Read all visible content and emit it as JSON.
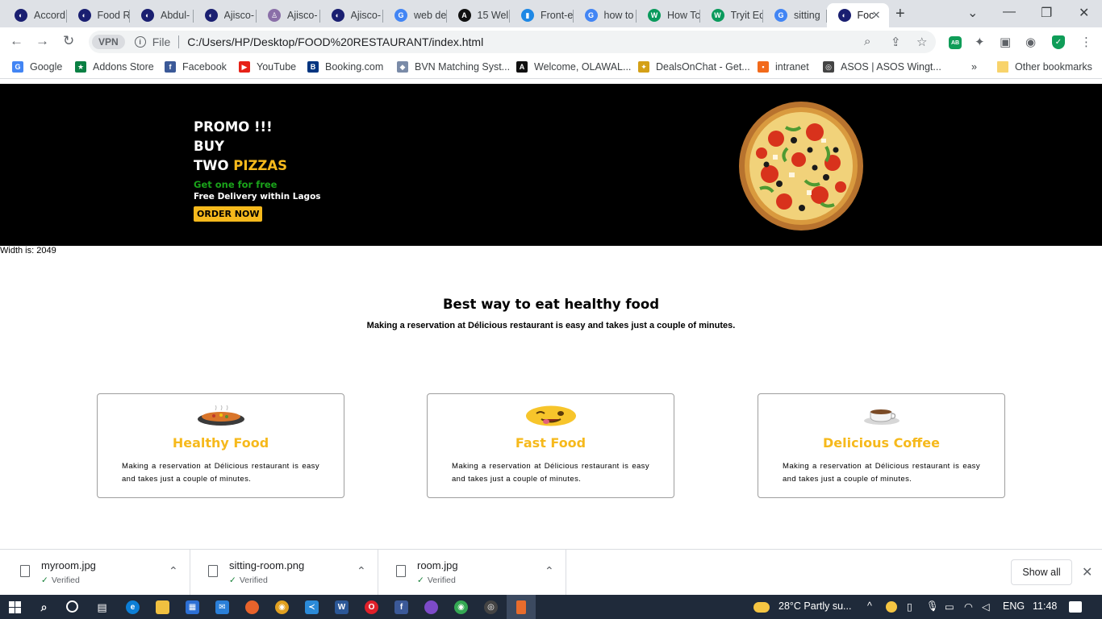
{
  "browser": {
    "tabs": [
      {
        "label": "Accord",
        "color": "#1a1f71",
        "glyph": "◐"
      },
      {
        "label": "Food R",
        "color": "#1a1f71",
        "glyph": "◐"
      },
      {
        "label": "Abdul-",
        "color": "#1a1f71",
        "glyph": "◐"
      },
      {
        "label": "Ajisco-",
        "color": "#1a1f71",
        "glyph": "◐"
      },
      {
        "label": "Ajisco-",
        "color": "#8a6fa8",
        "glyph": "♙"
      },
      {
        "label": "Ajisco-",
        "color": "#1a1f71",
        "glyph": "◐"
      },
      {
        "label": "web de",
        "color": "#4285f4",
        "glyph": "G"
      },
      {
        "label": "15 Wel",
        "color": "#111",
        "glyph": "A"
      },
      {
        "label": "Front-e",
        "color": "#1e88e5",
        "glyph": "▮"
      },
      {
        "label": "how to",
        "color": "#4285f4",
        "glyph": "G"
      },
      {
        "label": "How Tc",
        "color": "#0a9a5c",
        "glyph": "W"
      },
      {
        "label": "Tryit Ed",
        "color": "#0a9a5c",
        "glyph": "W"
      },
      {
        "label": "sitting",
        "color": "#4285f4",
        "glyph": "G"
      },
      {
        "label": "Foc",
        "color": "#1a1f71",
        "glyph": "◐",
        "active": true
      }
    ],
    "tab_close": "✕",
    "new_tab": "+",
    "window_controls": {
      "chevron": "⌄",
      "minimize": "—",
      "restore": "❐",
      "close": "✕"
    },
    "nav": {
      "back": "←",
      "forward": "→",
      "reload": "↻"
    },
    "vpn_label": "VPN",
    "info_glyph": "i",
    "file_label": "File",
    "url": "C:/Users/HP/Desktop/FOOD%20RESTAURANT/index.html",
    "toolbar_icons": {
      "zoom": "⌕",
      "share": "⇪",
      "star": "☆",
      "adblock": "AB",
      "extensions": "✦",
      "sidepanel": "▣",
      "profile": "◉",
      "shield": "✓",
      "menu": "⋮"
    },
    "bookmarks": [
      {
        "label": "Google",
        "color": "#4285f4",
        "glyph": "G"
      },
      {
        "label": "Addons Store",
        "color": "#0a8043",
        "glyph": "★"
      },
      {
        "label": "Facebook",
        "color": "#3b5998",
        "glyph": "f"
      },
      {
        "label": "YouTube",
        "color": "#e62117",
        "glyph": "▶"
      },
      {
        "label": "Booking.com",
        "color": "#003580",
        "glyph": "B"
      },
      {
        "label": "BVN Matching Syst...",
        "color": "#7a8ba8",
        "glyph": "◆"
      },
      {
        "label": "Welcome, OLAWAL...",
        "color": "#111",
        "glyph": "A"
      },
      {
        "label": "DealsOnChat - Get...",
        "color": "#d4a017",
        "glyph": "✦"
      },
      {
        "label": "intranet",
        "color": "#f26a1b",
        "glyph": "▪"
      },
      {
        "label": "ASOS | ASOS Wingt...",
        "color": "#444",
        "glyph": "◎"
      }
    ],
    "bookmarks_more": "»",
    "other_bookmarks": "Other bookmarks"
  },
  "page": {
    "promo_line1": "PROMO !!!",
    "promo_line2": "BUY",
    "promo_line3_a": "TWO",
    "promo_line3_b": "PIZZAS",
    "promo_free": "Get one for free",
    "promo_delivery": "Free Delivery within Lagos",
    "order_button": "ORDER NOW",
    "width_text": "Width is: 2049",
    "section_title": "Best way to eat healthy food",
    "section_subtitle": "Making a reservation at Délicious restaurant is easy and takes just a couple of minutes.",
    "cards": [
      {
        "title": "Healthy Food",
        "icon": "paella-pan-icon",
        "text": "Making a reservation at Délicious restaurant is easy and takes just a couple of minutes."
      },
      {
        "title": "Fast Food",
        "icon": "winking-face-icon",
        "text": "Making a reservation at Délicious restaurant is easy and takes just a couple of minutes."
      },
      {
        "title": "Delicious Coffee",
        "icon": "coffee-cup-icon",
        "text": "Making a reservation at Délicious restaurant is easy and takes just a couple of minutes."
      }
    ],
    "colors": {
      "accent": "#f6b91c",
      "promo_green": "#1aa31a",
      "hero_bg": "#000000"
    }
  },
  "downloads": {
    "items": [
      {
        "name": "myroom.jpg",
        "status": "Verified"
      },
      {
        "name": "sitting-room.png",
        "status": "Verified"
      },
      {
        "name": "room.jpg",
        "status": "Verified"
      }
    ],
    "check_glyph": "✓",
    "chevron_glyph": "⌃",
    "show_all": "Show all",
    "close_glyph": "✕"
  },
  "taskbar": {
    "weather": "28°C  Partly su...",
    "language": "ENG",
    "time": "11:48",
    "tray_up": "^"
  }
}
